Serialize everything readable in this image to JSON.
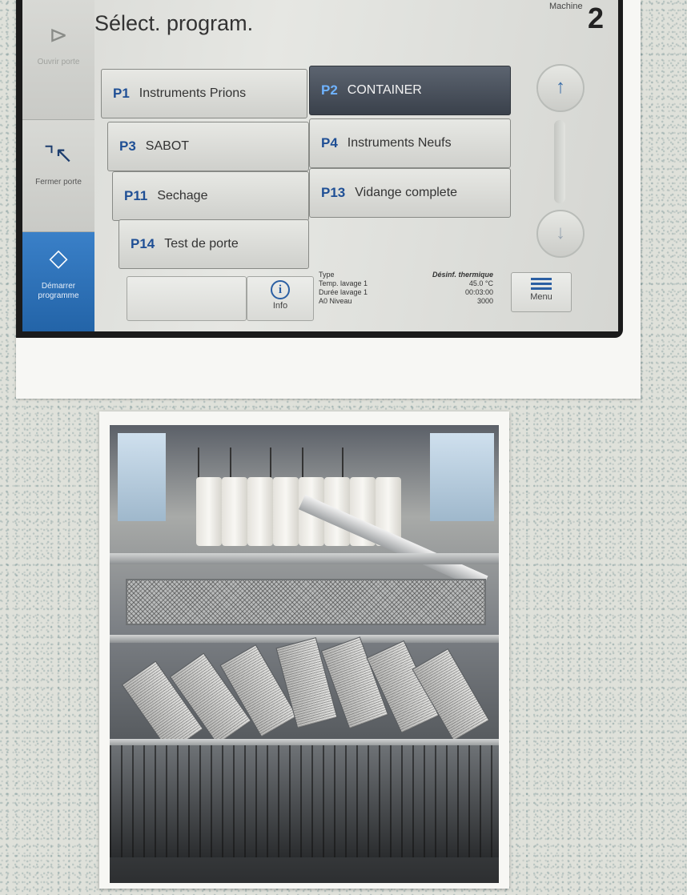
{
  "header": {
    "title": "Sélect. program.",
    "machine_label": "Machine",
    "machine_number": "2"
  },
  "sidebar": {
    "open_door": "Ouvrir porte",
    "close_door": "Fermer porte",
    "start_program": "Démarrer programme"
  },
  "programs": [
    {
      "code": "P1",
      "name": "Instruments Prions",
      "selected": false
    },
    {
      "code": "P2",
      "name": "CONTAINER",
      "selected": true
    },
    {
      "code": "P3",
      "name": "SABOT",
      "selected": false
    },
    {
      "code": "P4",
      "name": "Instruments Neufs",
      "selected": false
    },
    {
      "code": "P11",
      "name": "Sechage",
      "selected": false
    },
    {
      "code": "P13",
      "name": "Vidange complete",
      "selected": false
    },
    {
      "code": "P14",
      "name": "Test de porte",
      "selected": false
    }
  ],
  "footer": {
    "info_label": "Info",
    "menu_label": "Menu"
  },
  "details": [
    {
      "label": "Type",
      "value": "Désinf. thermique"
    },
    {
      "label": "Temp. lavage 1",
      "value": "45.0   °C"
    },
    {
      "label": "Durée lavage 1",
      "value": "00:03:00"
    },
    {
      "label": "A0 Niveau",
      "value": "3000"
    }
  ],
  "colors": {
    "accent": "#2364a8",
    "selected_program": "#3a414b",
    "program_code": "#1f4f95"
  },
  "icons": {
    "open_door": "open-door-icon",
    "close_door": "close-door-icon",
    "start": "start-diamond-icon",
    "scroll_up": "arrow-up-icon",
    "scroll_down": "arrow-down-icon",
    "info": "info-icon",
    "menu": "menu-icon"
  }
}
